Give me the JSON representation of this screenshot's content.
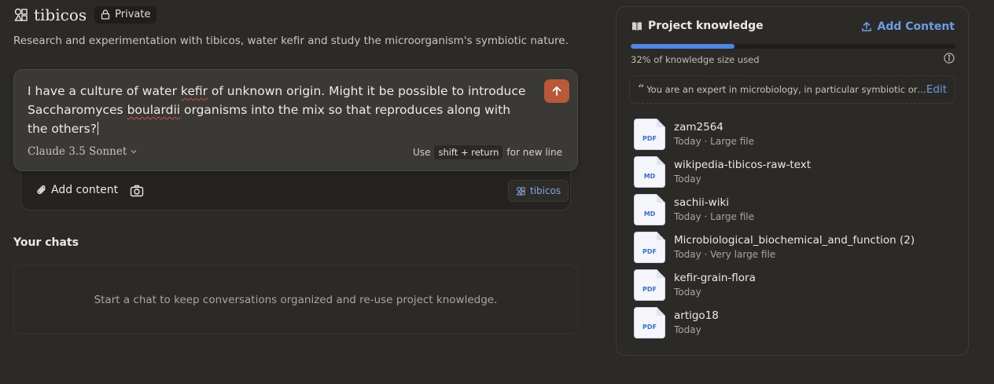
{
  "project": {
    "title": "tibicos",
    "visibility": "Private",
    "description": "Research and experimentation with tibicos, water kefir and study the microorganism's symbiotic nature."
  },
  "composer": {
    "text_before_kefir": "I have a culture of water ",
    "misspelled_1": "kefir",
    "text_mid": " of unknown origin. Might it be possible to introduce Saccharomyces ",
    "misspelled_2": "boulardii",
    "text_after": " organisms into the mix so that reproduces along with the others?",
    "model": "Claude 3.5 Sonnet",
    "hint_prefix": "Use",
    "hint_keys": "shift + return",
    "hint_suffix": "for new line",
    "add_content_label": "Add content",
    "project_chip": "tibicos",
    "send_color": "#b8593a"
  },
  "chats": {
    "title": "Your chats",
    "empty_text": "Start a chat to keep conversations organized and re-use project knowledge."
  },
  "knowledge": {
    "title": "Project knowledge",
    "add_label": "Add Content",
    "usage_fraction": 0.32,
    "usage_text": "32% of knowledge size used",
    "instructions": "You are an expert in microbiology, in particular symbiotic orga...",
    "edit_label": "Edit",
    "accent": "#6d9ce6",
    "files": [
      {
        "name": "zam2564",
        "type": "PDF",
        "meta": "Today · Large file"
      },
      {
        "name": "wikipedia-tibicos-raw-text",
        "type": "MD",
        "meta": "Today"
      },
      {
        "name": "sachii-wiki",
        "type": "MD",
        "meta": "Today · Large file"
      },
      {
        "name": "Microbiological_biochemical_and_function (2)",
        "type": "PDF",
        "meta": "Today · Very large file"
      },
      {
        "name": "kefir-grain-flora",
        "type": "PDF",
        "meta": "Today"
      },
      {
        "name": "artigo18",
        "type": "PDF",
        "meta": "Today"
      }
    ]
  }
}
